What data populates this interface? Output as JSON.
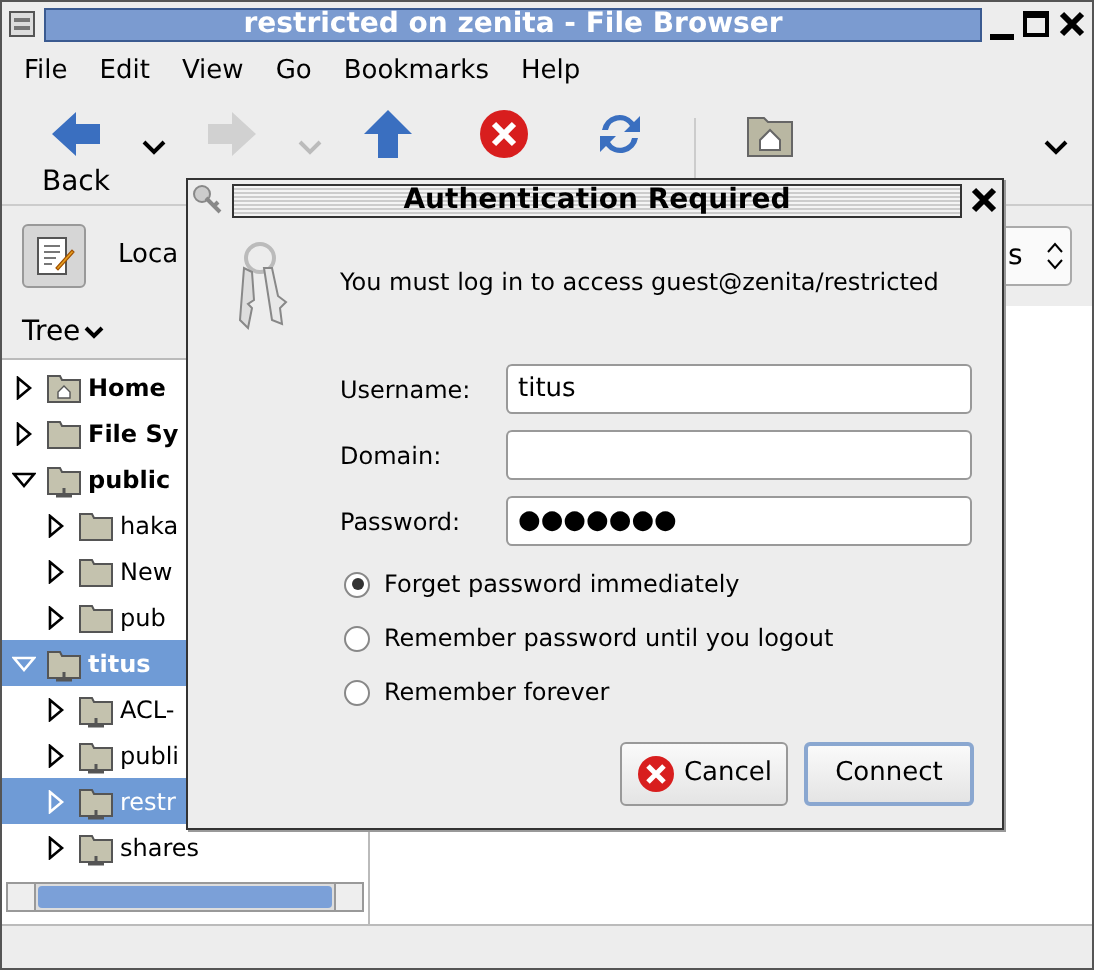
{
  "window": {
    "title": "restricted on zenita - File Browser"
  },
  "menu": [
    "File",
    "Edit",
    "View",
    "Go",
    "Bookmarks",
    "Help"
  ],
  "toolbar": [
    {
      "label": "Back",
      "kind": "back",
      "disabled": false,
      "dropdown": true
    },
    {
      "kind": "forward",
      "disabled": true,
      "dropdown": true
    },
    {
      "kind": "up",
      "disabled": false
    },
    {
      "kind": "stop",
      "disabled": false
    },
    {
      "kind": "reload",
      "disabled": false
    },
    {
      "kind": "home",
      "disabled": false
    }
  ],
  "location": {
    "label": "Loca",
    "view_combo": "s"
  },
  "sidebar": {
    "title": "Tree",
    "items": [
      {
        "label": "Home",
        "kind": "home",
        "expanded": false,
        "selected": false
      },
      {
        "label": "File Sy",
        "kind": "folder",
        "expanded": false,
        "selected": false
      },
      {
        "label": "public",
        "kind": "share",
        "expanded": true,
        "selected": false,
        "children": [
          {
            "label": "haka",
            "kind": "folder",
            "expanded": false,
            "selected": false
          },
          {
            "label": "New",
            "kind": "folder",
            "expanded": false,
            "selected": false
          },
          {
            "label": "pub",
            "kind": "folder",
            "expanded": false,
            "selected": false
          }
        ]
      },
      {
        "label": "titus",
        "kind": "share",
        "expanded": true,
        "selected": true,
        "children": [
          {
            "label": "ACL-",
            "kind": "share",
            "expanded": false,
            "selected": false
          },
          {
            "label": "publi",
            "kind": "share",
            "expanded": false,
            "selected": false
          },
          {
            "label": "restr",
            "kind": "share",
            "expanded": false,
            "selected": true
          },
          {
            "label": "shares",
            "kind": "share",
            "expanded": false,
            "selected": false
          }
        ]
      }
    ]
  },
  "dialog": {
    "title": "Authentication Required",
    "message": "You must log in to access guest@zenita/restricted",
    "fields": [
      {
        "label": "Username:",
        "value": "titus"
      },
      {
        "label": "Domain:"
      },
      {
        "label": "Password:",
        "value": "●●●●●●●"
      }
    ],
    "options": [
      {
        "label": "Forget password immediately",
        "selected": true
      },
      {
        "label": "Remember password until you logout",
        "selected": false
      },
      {
        "label": "Remember forever",
        "selected": false
      }
    ],
    "buttons": [
      {
        "label": "Cancel",
        "kind": "cancel"
      },
      {
        "label": "Connect",
        "kind": "default"
      }
    ]
  }
}
